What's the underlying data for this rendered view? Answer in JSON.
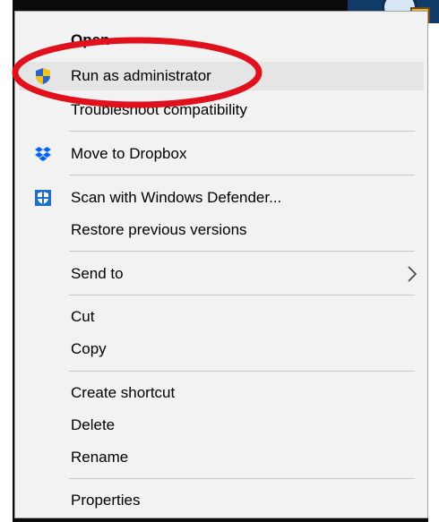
{
  "menu": {
    "items": [
      {
        "label": "Open"
      },
      {
        "label": "Run as administrator"
      },
      {
        "label": "Troubleshoot compatibility"
      },
      {
        "label": "Move to Dropbox"
      },
      {
        "label": "Scan with Windows Defender..."
      },
      {
        "label": "Restore previous versions"
      },
      {
        "label": "Send to"
      },
      {
        "label": "Cut"
      },
      {
        "label": "Copy"
      },
      {
        "label": "Create shortcut"
      },
      {
        "label": "Delete"
      },
      {
        "label": "Rename"
      },
      {
        "label": "Properties"
      }
    ],
    "icons": {
      "run_as_admin": "uac-shield-icon",
      "dropbox": "dropbox-icon",
      "defender": "windows-defender-icon",
      "send_to": "chevron-right-icon"
    }
  },
  "colors": {
    "menu_bg": "#f2f2f2",
    "hover_bg": "#e5e5e5",
    "annotation_red": "#e0101c",
    "dropbox_blue": "#0061fe",
    "defender_blue": "#1f6fd1"
  }
}
